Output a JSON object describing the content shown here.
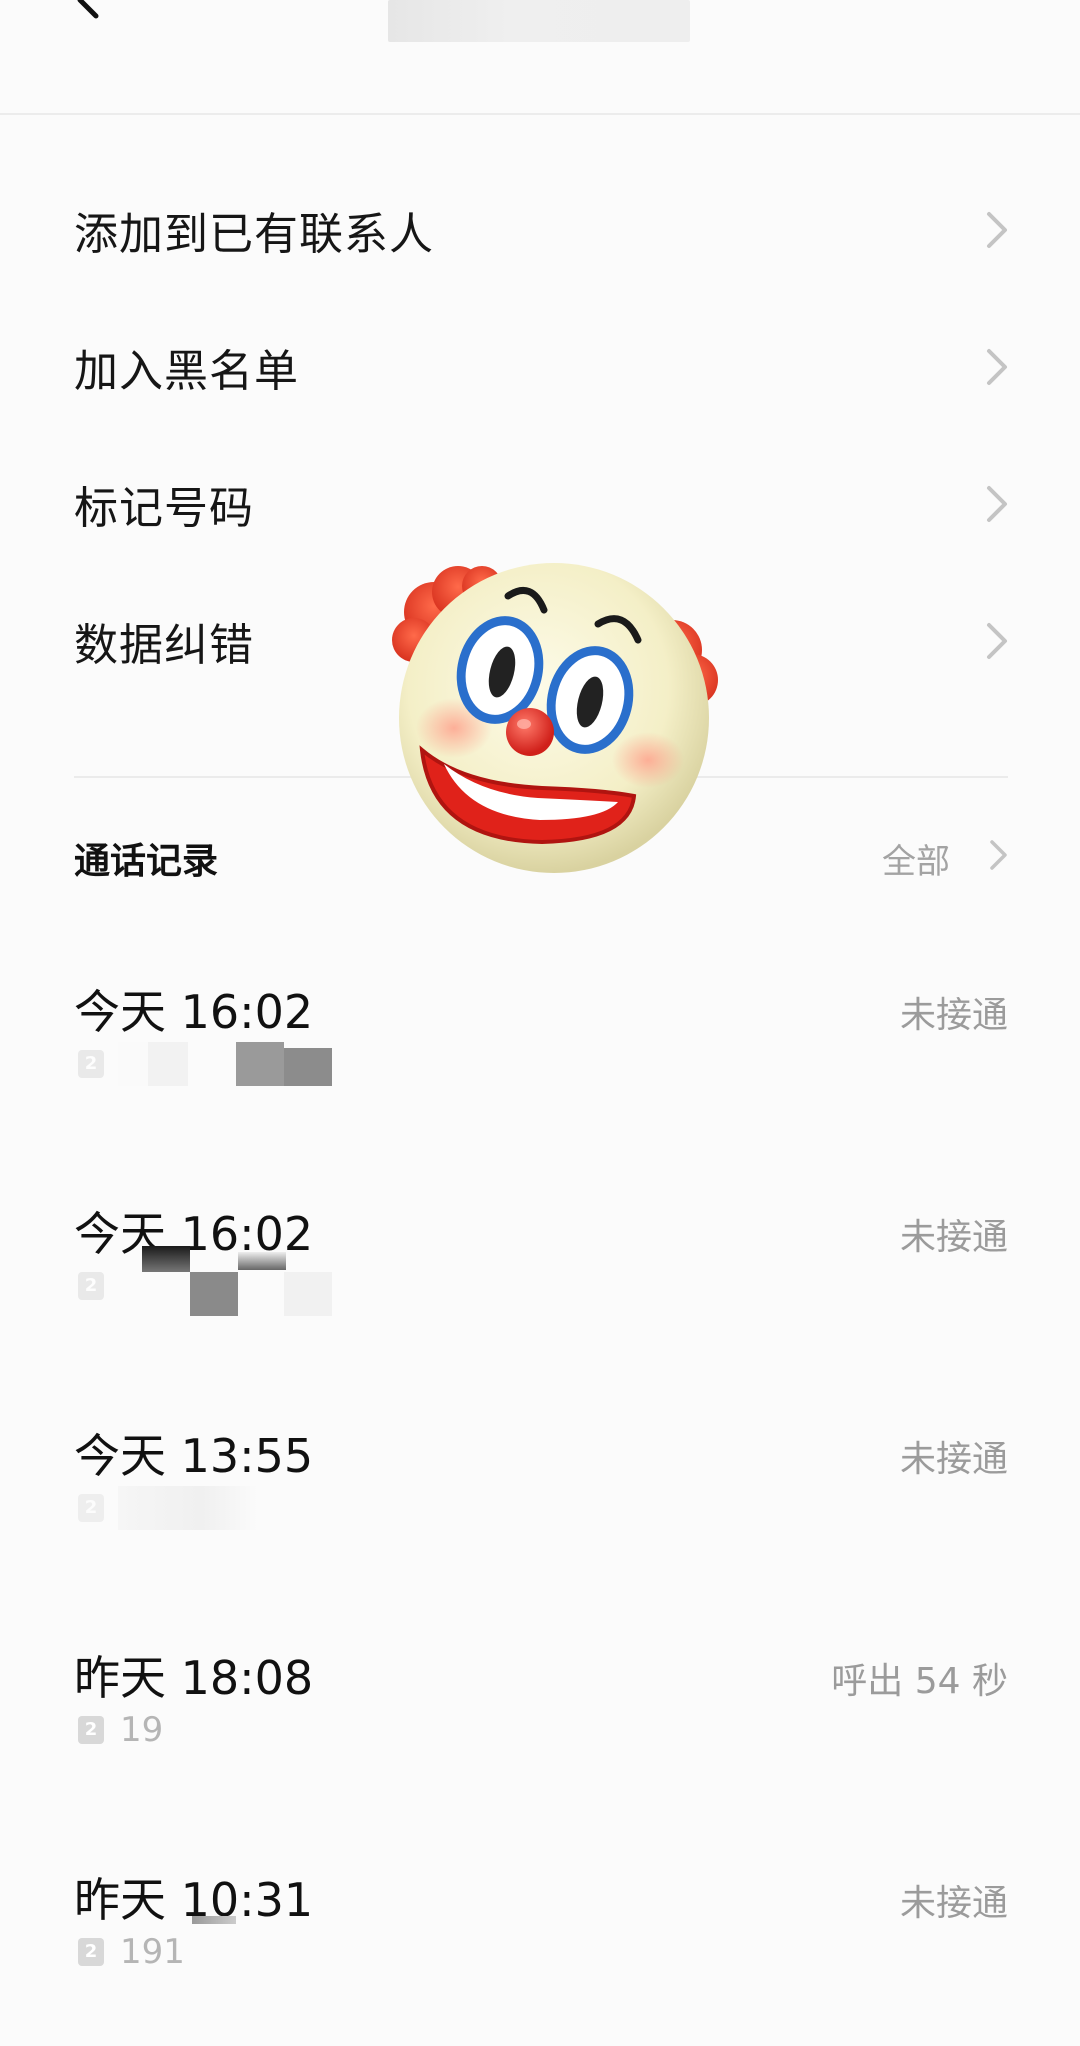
{
  "header": {
    "back_icon": "chevron-left-icon",
    "title": ""
  },
  "menu": {
    "items": [
      {
        "label": "添加到已有联系人"
      },
      {
        "label": "加入黑名单"
      },
      {
        "label": "标记号码"
      },
      {
        "label": "数据纠错"
      }
    ]
  },
  "call_log": {
    "title": "通话记录",
    "view_all_label": "全部",
    "entries": [
      {
        "time": "今天 16:02",
        "status": "未接通",
        "sim": "2",
        "number": ""
      },
      {
        "time": "今天 16:02",
        "status": "未接通",
        "sim": "2",
        "number": ""
      },
      {
        "time": "今天 13:55",
        "status": "未接通",
        "sim": "2",
        "number": ""
      },
      {
        "time": "昨天 18:08",
        "status": "呼出 54 秒",
        "sim": "2",
        "number": "19"
      },
      {
        "time": "昨天 10:31",
        "status": "未接通",
        "sim": "2",
        "number": "191"
      }
    ]
  },
  "overlay": {
    "sticker": "clown-face-emoji"
  },
  "colors": {
    "background": "#fbfbfb",
    "text_primary": "#111111",
    "text_secondary": "#9b9b9b",
    "chevron": "#c4c4c4"
  }
}
